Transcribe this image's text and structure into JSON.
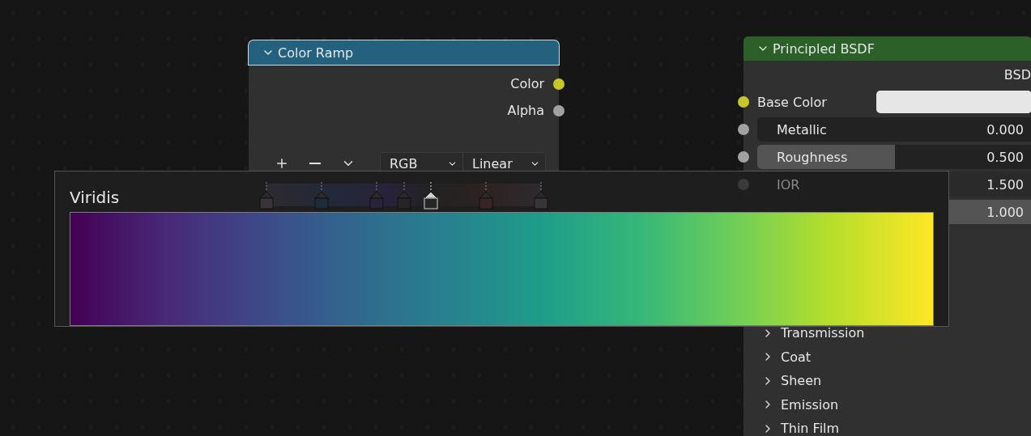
{
  "color_ramp_node": {
    "title": "Color Ramp",
    "outputs": [
      {
        "label": "Color",
        "color": "#c7c729"
      },
      {
        "label": "Alpha",
        "color": "#a1a1a1"
      }
    ],
    "color_mode": "RGB",
    "interpolation": "Linear",
    "stops": [
      {
        "level": 0,
        "color": "#3a3438",
        "selected": false
      },
      {
        "level": 0.2,
        "color": "#1f2a3a",
        "selected": false
      },
      {
        "level": 0.4,
        "color": "#2a2238",
        "selected": false
      },
      {
        "level": 0.5,
        "color": "#262428",
        "selected": false
      },
      {
        "level": 0.6,
        "color": "#262626",
        "selected": true
      },
      {
        "level": 0.8,
        "color": "#3a2424",
        "selected": false
      },
      {
        "level": 1,
        "color": "#3a3438",
        "selected": false
      }
    ]
  },
  "principled_node": {
    "title": "Principled BSDF",
    "output": "BSD",
    "inputs": [
      {
        "kind": "color",
        "label": "Base Color",
        "color": "#c7c729"
      },
      {
        "kind": "slider",
        "label": "Metallic",
        "value": "0.000",
        "level": 0,
        "color": "#a1a1a1"
      },
      {
        "kind": "slider",
        "label": "Roughness",
        "value": "0.500",
        "level": 0.5,
        "color": "#a1a1a1"
      },
      {
        "kind": "number",
        "label": "IOR",
        "value": "1.500",
        "color": "#3a3a3a"
      },
      {
        "kind": "slider",
        "value": "1.000",
        "level": 1
      }
    ],
    "panels": [
      {
        "label": "Transmission",
        "expanded": false
      },
      {
        "label": "Coat",
        "expanded": false
      },
      {
        "label": "Sheen",
        "expanded": false
      },
      {
        "label": "Emission",
        "expanded": false
      },
      {
        "label": "Thin Film",
        "expanded": false
      }
    ]
  },
  "tooltip": {
    "title": "Viridis"
  }
}
